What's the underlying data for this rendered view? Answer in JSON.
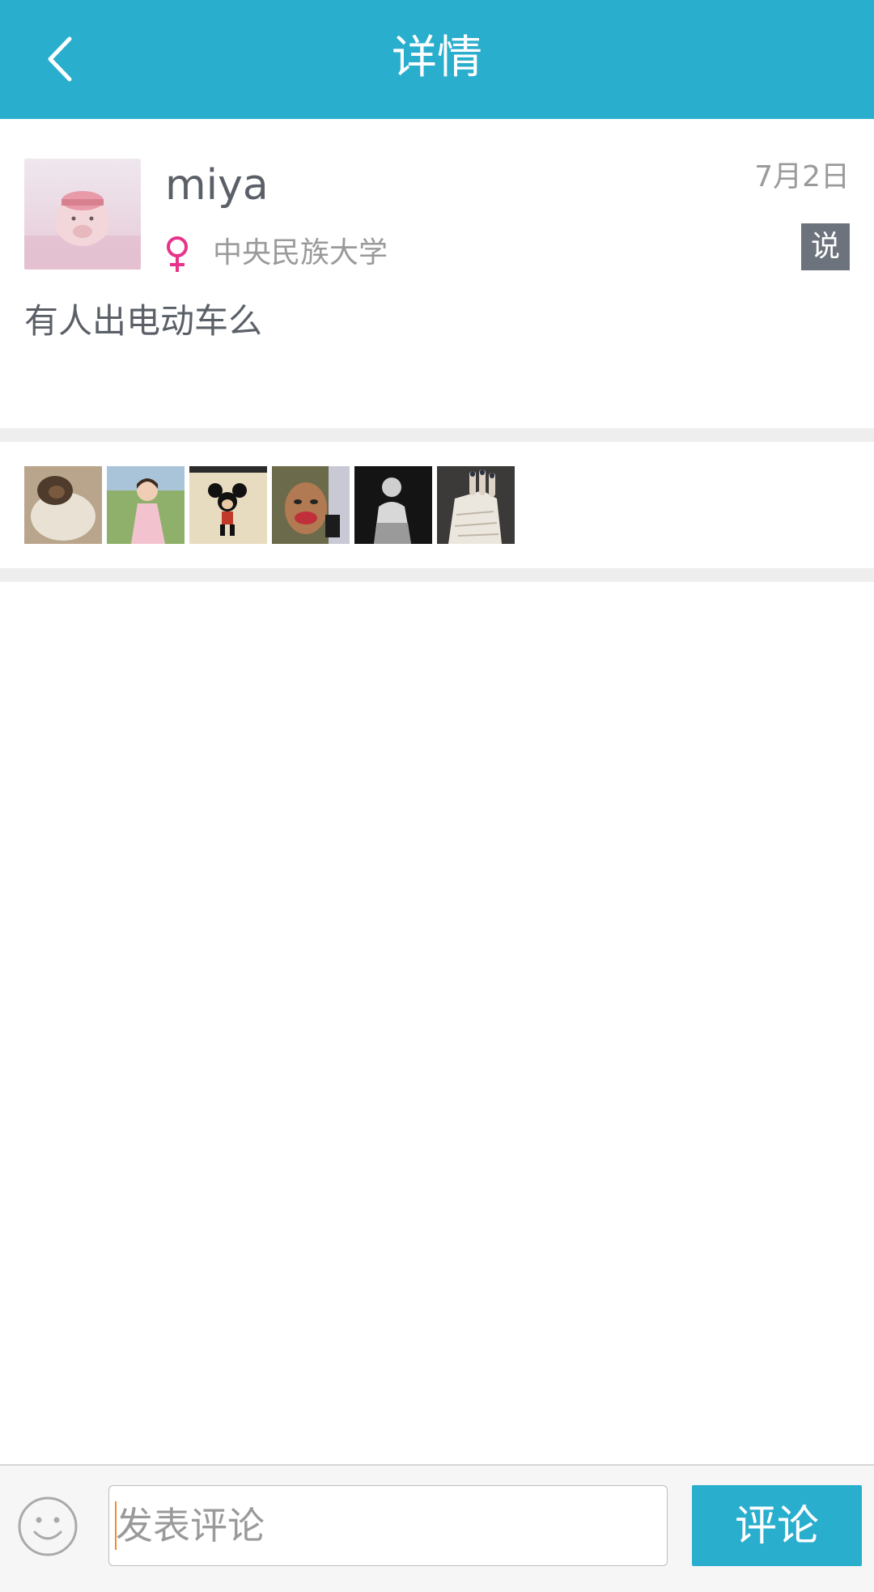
{
  "header": {
    "title": "详情",
    "back_icon": "chevron-left-icon"
  },
  "post": {
    "author": "miya",
    "date": "7月2日",
    "gender": "female",
    "gender_icon": "female-icon",
    "gender_color": "#e8338a",
    "school": "中央民族大学",
    "type_badge": "说",
    "content": "有人出电动车么"
  },
  "likers": {
    "count": 6
  },
  "comment_bar": {
    "emoji_icon": "smiley-icon",
    "input_placeholder": "发表评论",
    "submit_label": "评论"
  },
  "colors": {
    "accent": "#2aaecd",
    "badge": "#6c737c"
  }
}
